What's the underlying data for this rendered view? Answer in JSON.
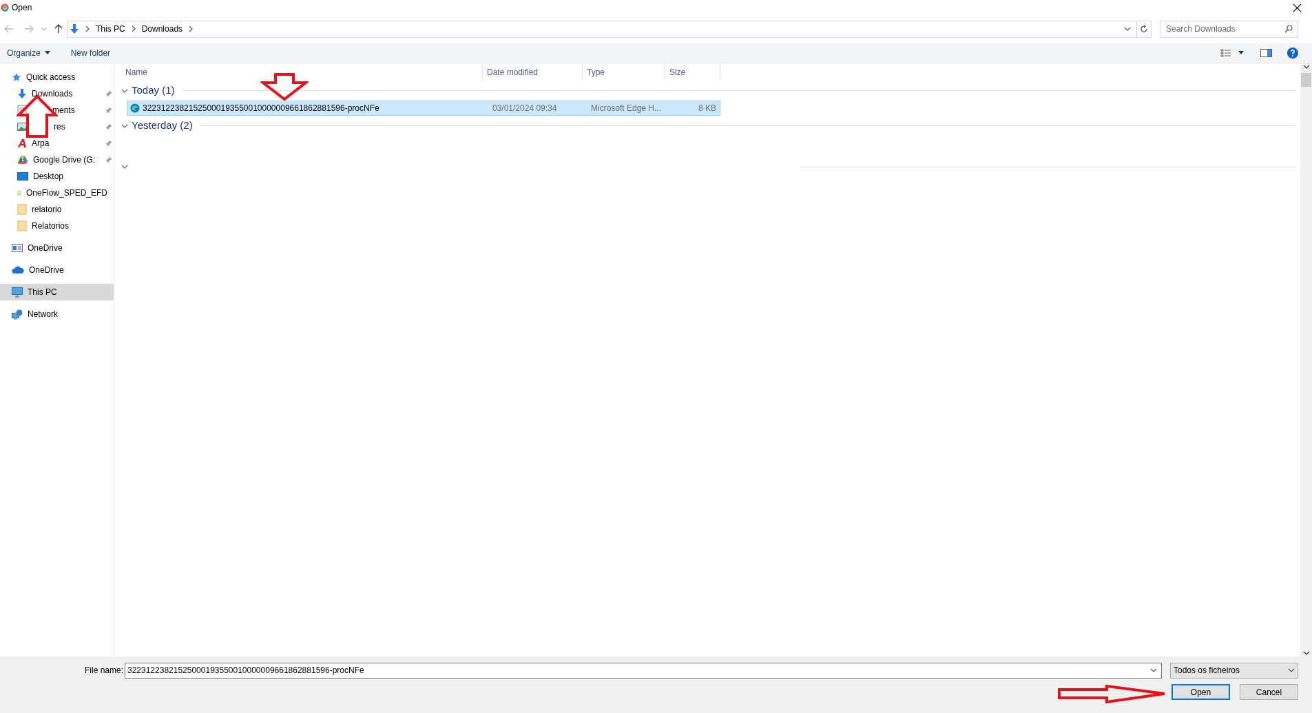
{
  "window": {
    "title": "Open"
  },
  "address_bar": {
    "segments": [
      "This PC",
      "Downloads"
    ]
  },
  "search": {
    "placeholder": "Search Downloads"
  },
  "toolbar": {
    "buttons": [
      "Organize",
      "New folder"
    ]
  },
  "sidebar": {
    "items": [
      {
        "label": "Quick access",
        "selected": false,
        "children": [
          {
            "label": "Downloads",
            "pinned": true,
            "selected": false
          },
          {
            "label": "ments",
            "pinned": true,
            "selected": false,
            "kind": "covered"
          },
          {
            "label": "res",
            "pinned": true,
            "selected": false,
            "kind": "covered"
          },
          {
            "label": "Arpa",
            "pinned": true,
            "selected": false
          },
          {
            "label": "Google Drive (G:",
            "pinned": true,
            "selected": false
          },
          {
            "label": "Desktop",
            "pinned": false,
            "selected": false
          },
          {
            "label": "OneFlow_SPED_EFD",
            "pinned": false,
            "selected": false
          },
          {
            "label": "relatorio",
            "pinned": false,
            "selected": false
          },
          {
            "label": "Relatorios",
            "pinned": false,
            "selected": false
          }
        ]
      },
      {
        "label": "OneDrive",
        "selected": false
      },
      {
        "label": "OneDrive",
        "selected": false
      },
      {
        "label": "This PC",
        "selected": true
      },
      {
        "label": "Network",
        "selected": false
      }
    ]
  },
  "columns": [
    "Name",
    "Date modified",
    "Type",
    "Size"
  ],
  "groups": [
    {
      "label": "Today (1)",
      "rows": [
        {
          "name": "32231223821525000193550010000009661862881596-procNFe",
          "date": "03/01/2024 09:34",
          "type": "Microsoft Edge H...",
          "size": "8 KB",
          "selected": true
        }
      ]
    },
    {
      "label": "Yesterday (2)"
    }
  ],
  "file_name": {
    "label": "File name:",
    "value": "32231223821525000193550010000009661862881596-procNFe"
  },
  "file_type": {
    "value": "Todos os ficheiros"
  },
  "buttons": [
    {
      "label": "Open",
      "focused": true
    },
    {
      "label": "Cancel",
      "focused": false
    }
  ]
}
